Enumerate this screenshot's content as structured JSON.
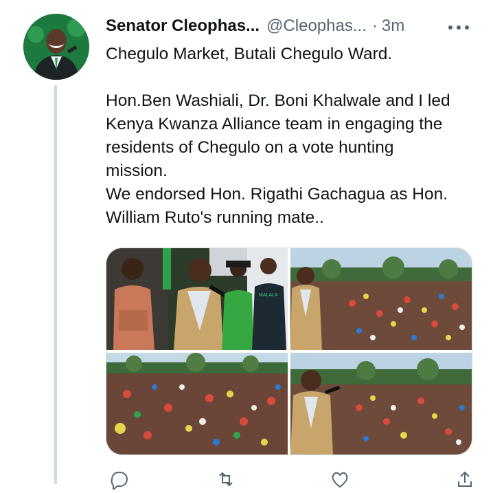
{
  "tweet": {
    "author_name": "Senator Cleophas...",
    "author_handle": "@Cleophas...",
    "separator": "·",
    "timestamp": "3m",
    "text_line_1": "Chegulo Market, Butali Chegulo Ward.",
    "text_body": "Hon.Ben Washiali, Dr. Boni Khalwale and I led\nKenya Kwanza Alliance team in engaging the\nresidents of Chegulo on a vote hunting\nmission.\nWe endorsed Hon. Rigathi Gachagua as Hon.\nWilliam Ruto's running mate..",
    "photos": [
      {
        "icon": "photo-speaker-crowd"
      },
      {
        "icon": "photo-rally-crowd"
      },
      {
        "icon": "photo-crowd-wide"
      },
      {
        "icon": "photo-speaker-rally"
      }
    ]
  },
  "ui": {
    "more_icon": "more-horizontal-icon",
    "action_icons": [
      "reply-icon",
      "retweet-icon",
      "like-icon",
      "share-icon"
    ],
    "colors": {
      "text": "#0f1419",
      "secondary": "#536471",
      "border": "#cfd9de"
    }
  }
}
